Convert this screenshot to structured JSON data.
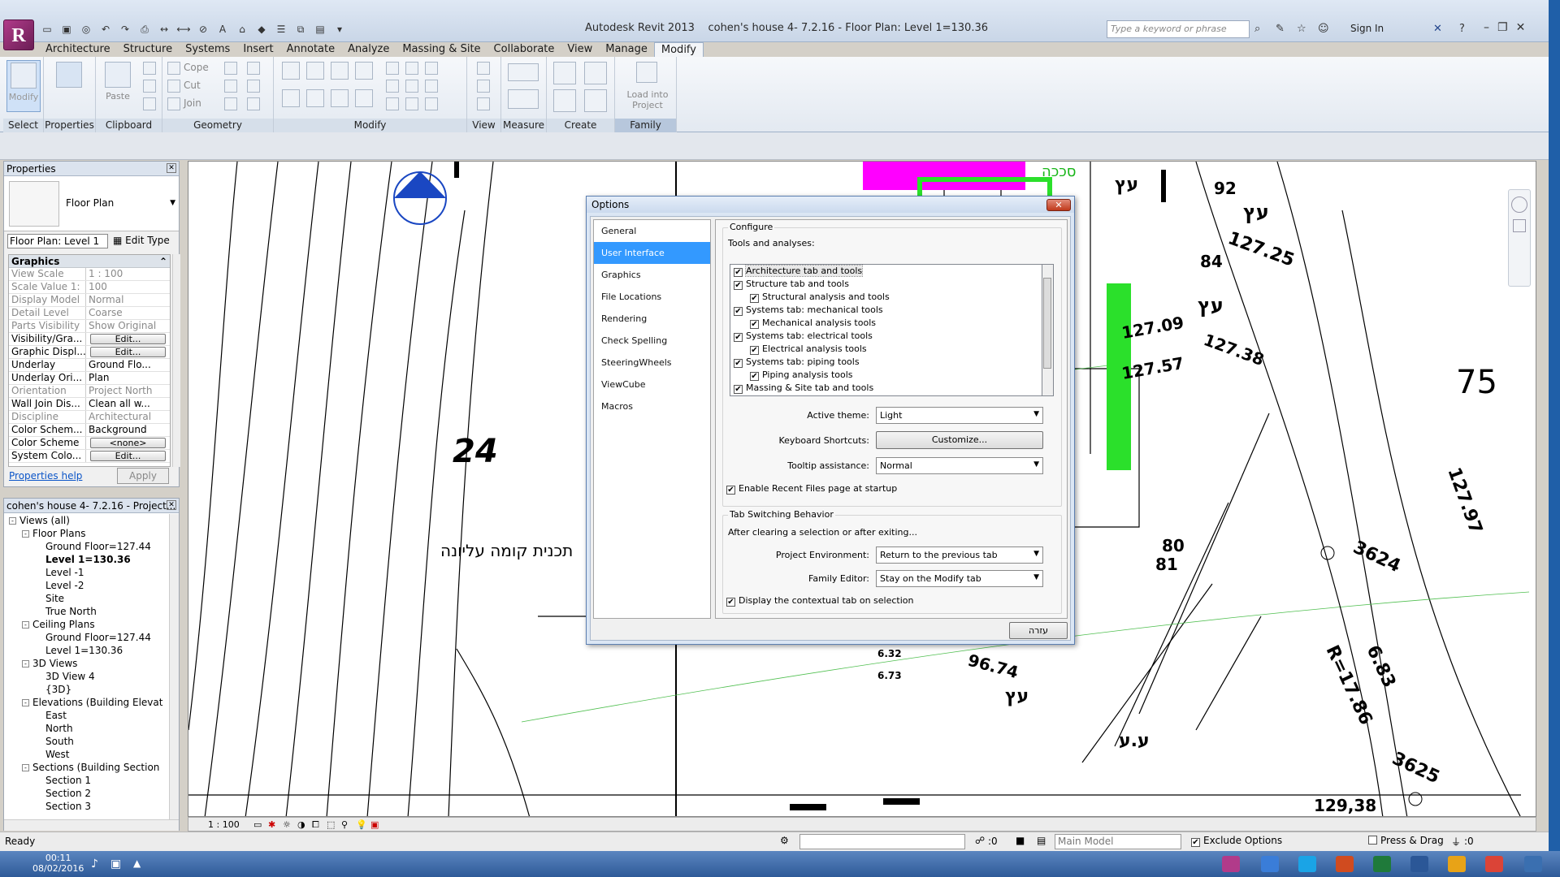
{
  "window": {
    "app_name": "Autodesk Revit 2013",
    "doc_title": "cohen's house 4- 7.2.16 - Floor Plan: Level 1=130.36",
    "search_placeholder": "Type a keyword or phrase",
    "sign_in": "Sign In"
  },
  "ribbon": {
    "tabs": [
      "Architecture",
      "Structure",
      "Systems",
      "Insert",
      "Annotate",
      "Analyze",
      "Massing & Site",
      "Collaborate",
      "View",
      "Manage",
      "Modify"
    ],
    "active_tab": "Modify",
    "groups": [
      "Select",
      "Properties",
      "Clipboard",
      "Geometry",
      "Modify",
      "View",
      "Measure",
      "Create",
      "Family Editor"
    ],
    "buttons": {
      "modify": "Modify",
      "paste": "Paste",
      "cope": "Cope",
      "cut": "Cut",
      "join": "Join",
      "load_into_project": "Load into Project"
    }
  },
  "properties": {
    "title": "Properties",
    "type_name": "Floor Plan",
    "instance_selector": "Floor Plan: Level 1",
    "edit_type": "Edit Type",
    "section": "Graphics",
    "rows": [
      {
        "k": "View Scale",
        "v": "1 : 100",
        "ro": true
      },
      {
        "k": "Scale Value 1:",
        "v": "100",
        "ro": true
      },
      {
        "k": "Display Model",
        "v": "Normal",
        "ro": true
      },
      {
        "k": "Detail Level",
        "v": "Coarse",
        "ro": true
      },
      {
        "k": "Parts Visibility",
        "v": "Show Original",
        "ro": true
      },
      {
        "k": "Visibility/Gra...",
        "v": "Edit...",
        "btn": true
      },
      {
        "k": "Graphic Displ...",
        "v": "Edit...",
        "btn": true
      },
      {
        "k": "Underlay",
        "v": "Ground Flo..."
      },
      {
        "k": "Underlay Ori...",
        "v": "Plan"
      },
      {
        "k": "Orientation",
        "v": "Project North",
        "ro": true
      },
      {
        "k": "Wall Join Dis...",
        "v": "Clean all w..."
      },
      {
        "k": "Discipline",
        "v": "Architectural",
        "ro": true
      },
      {
        "k": "Color Schem...",
        "v": "Background"
      },
      {
        "k": "Color Scheme",
        "v": "<none>",
        "btn": true
      },
      {
        "k": "System Colo...",
        "v": "Edit...",
        "btn": true
      }
    ],
    "help_link": "Properties help",
    "apply": "Apply"
  },
  "browser": {
    "title": "cohen's house 4- 7.2.16 - Project...",
    "nodes": [
      {
        "d": 0,
        "t": "Views (all)",
        "tg": "-"
      },
      {
        "d": 1,
        "t": "Floor Plans",
        "tg": "-"
      },
      {
        "d": 2,
        "t": "Ground Floor=127.44"
      },
      {
        "d": 2,
        "t": "Level 1=130.36",
        "bold": true
      },
      {
        "d": 2,
        "t": "Level -1"
      },
      {
        "d": 2,
        "t": "Level -2"
      },
      {
        "d": 2,
        "t": "Site"
      },
      {
        "d": 2,
        "t": "True North"
      },
      {
        "d": 1,
        "t": "Ceiling Plans",
        "tg": "-"
      },
      {
        "d": 2,
        "t": "Ground Floor=127.44"
      },
      {
        "d": 2,
        "t": "Level 1=130.36"
      },
      {
        "d": 1,
        "t": "3D Views",
        "tg": "-"
      },
      {
        "d": 2,
        "t": "3D View 4"
      },
      {
        "d": 2,
        "t": "{3D}"
      },
      {
        "d": 1,
        "t": "Elevations (Building Elevat",
        "tg": "-"
      },
      {
        "d": 2,
        "t": "East"
      },
      {
        "d": 2,
        "t": "North"
      },
      {
        "d": 2,
        "t": "South"
      },
      {
        "d": 2,
        "t": "West"
      },
      {
        "d": 1,
        "t": "Sections (Building Section",
        "tg": "-"
      },
      {
        "d": 2,
        "t": "Section 1"
      },
      {
        "d": 2,
        "t": "Section 2"
      },
      {
        "d": 2,
        "t": "Section 3"
      }
    ]
  },
  "drawing": {
    "labels": {
      "plot24": "24",
      "hebrew_title": "תכנית קומה עליונה",
      "n75": "75",
      "n127_97": "127.97",
      "n3624": "3624",
      "n3625": "3625",
      "r": "R=17.86",
      "n6_83": "6.83",
      "n129_38": "129,38",
      "n6_32": "6.32",
      "n6_73": "6.73",
      "n127_25": "127.25",
      "n127_38": "127.38",
      "n127_09": "127.09",
      "n127_57": "127.57",
      "ets1": "עץ",
      "ets2": "עץ",
      "ets3": "עץ",
      "ets4": "עץ",
      "ets5": "ע.ע",
      "sukka": "סככה",
      "n92": "92",
      "n84": "84",
      "n80": "80",
      "n81": "81",
      "n96_74": "96.74"
    }
  },
  "viewbar": {
    "scale": "1 : 100"
  },
  "statusbar": {
    "status": "Ready",
    "zero1": ":0",
    "model": "Main Model",
    "exclude": "Exclude Options",
    "press_drag": "Press & Drag",
    "zero2": ":0"
  },
  "taskbar": {
    "time": "00:11",
    "date": "08/02/2016"
  },
  "dialog": {
    "title": "Options",
    "nav": [
      "General",
      "User Interface",
      "Graphics",
      "File Locations",
      "Rendering",
      "Check Spelling",
      "SteeringWheels",
      "ViewCube",
      "Macros"
    ],
    "selected_nav": "User Interface",
    "configure": "Configure",
    "tools_label": "Tools and analyses:",
    "tools": [
      {
        "t": "Architecture tab and tools",
        "d": 0,
        "c": true,
        "hl": true
      },
      {
        "t": "Structure tab and tools",
        "d": 0,
        "c": true
      },
      {
        "t": "Structural analysis and tools",
        "d": 1,
        "c": true
      },
      {
        "t": "Systems tab: mechanical tools",
        "d": 0,
        "c": true
      },
      {
        "t": "Mechanical analysis tools",
        "d": 1,
        "c": true
      },
      {
        "t": "Systems tab: electrical tools",
        "d": 0,
        "c": true
      },
      {
        "t": "Electrical analysis tools",
        "d": 1,
        "c": true
      },
      {
        "t": "Systems tab: piping tools",
        "d": 0,
        "c": true
      },
      {
        "t": "Piping analysis tools",
        "d": 1,
        "c": true
      },
      {
        "t": "Massing & Site tab and tools",
        "d": 0,
        "c": true
      }
    ],
    "active_theme_label": "Active theme:",
    "active_theme": "Light",
    "shortcuts_label": "Keyboard Shortcuts:",
    "customize": "Customize...",
    "tooltip_label": "Tooltip assistance:",
    "tooltip": "Normal",
    "recent_files": "Enable Recent Files page at startup",
    "tab_switching": "Tab Switching Behavior",
    "after_clearing": "After clearing a selection or after exiting...",
    "project_env_label": "Project Environment:",
    "project_env": "Return to the previous tab",
    "family_editor_label": "Family Editor:",
    "family_editor": "Stay on the Modify tab",
    "contextual": "Display the contextual tab on selection",
    "help_button": "עזרה"
  }
}
